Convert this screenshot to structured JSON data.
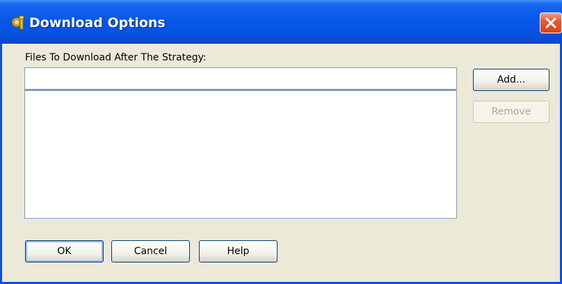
{
  "window": {
    "title": "Download Options",
    "icon": "gear-app-icon",
    "close_icon": "close-icon"
  },
  "files": {
    "label": "Files To Download After The Strategy:",
    "input_value": "",
    "list_items": []
  },
  "buttons": {
    "add": "Add...",
    "remove": "Remove",
    "ok": "OK",
    "cancel": "Cancel",
    "help": "Help"
  },
  "colors": {
    "titlebar": "#0757e6",
    "close": "#d84416",
    "dialog_bg": "#ece9d8",
    "field_border": "#7f9db9"
  }
}
